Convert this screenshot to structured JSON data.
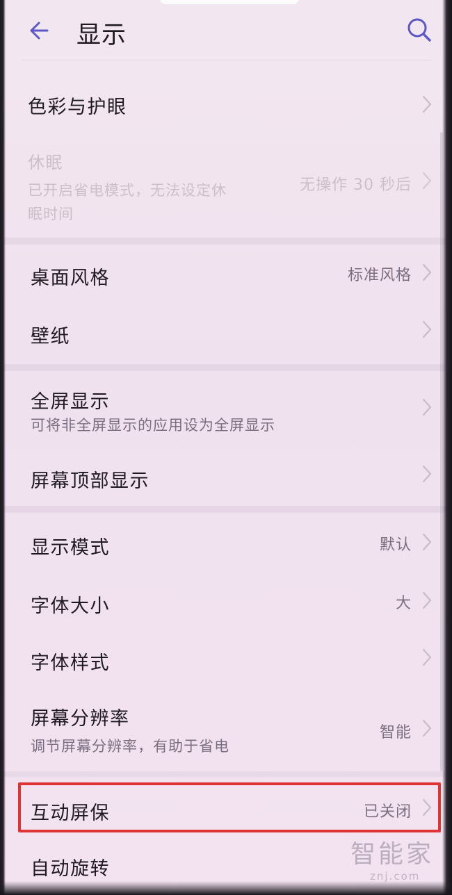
{
  "header": {
    "title": "显示"
  },
  "rows": {
    "color": {
      "label": "色彩与护眼"
    },
    "sleep": {
      "label": "休眠",
      "sub_line1": "已开启省电模式，无法设定休",
      "sub_line2": "眠时间",
      "value": "无操作 30 秒后"
    },
    "home_style": {
      "label": "桌面风格",
      "value": "标准风格"
    },
    "wallpaper": {
      "label": "壁纸"
    },
    "fullscreen": {
      "label": "全屏显示",
      "sub": "可将非全屏显示的应用设为全屏显示"
    },
    "top_display": {
      "label": "屏幕顶部显示"
    },
    "display_mode": {
      "label": "显示模式",
      "value": "默认"
    },
    "font_size": {
      "label": "字体大小",
      "value": "大"
    },
    "font_style": {
      "label": "字体样式"
    },
    "resolution": {
      "label": "屏幕分辨率",
      "sub": "调节屏幕分辨率，有助于省电",
      "value": "智能"
    },
    "screensaver": {
      "label": "互动屏保",
      "value": "已关闭"
    },
    "auto_rotate": {
      "label": "自动旋转"
    }
  },
  "watermark": {
    "text": "智能家",
    "url": "znj.com"
  },
  "colors": {
    "accent_icon": "#5b57c6",
    "highlight": "#e03434",
    "background": "#f1e4ef"
  },
  "icons": {
    "back": "arrow-left-icon",
    "search": "search-icon",
    "chevron": "chevron-right-icon"
  }
}
